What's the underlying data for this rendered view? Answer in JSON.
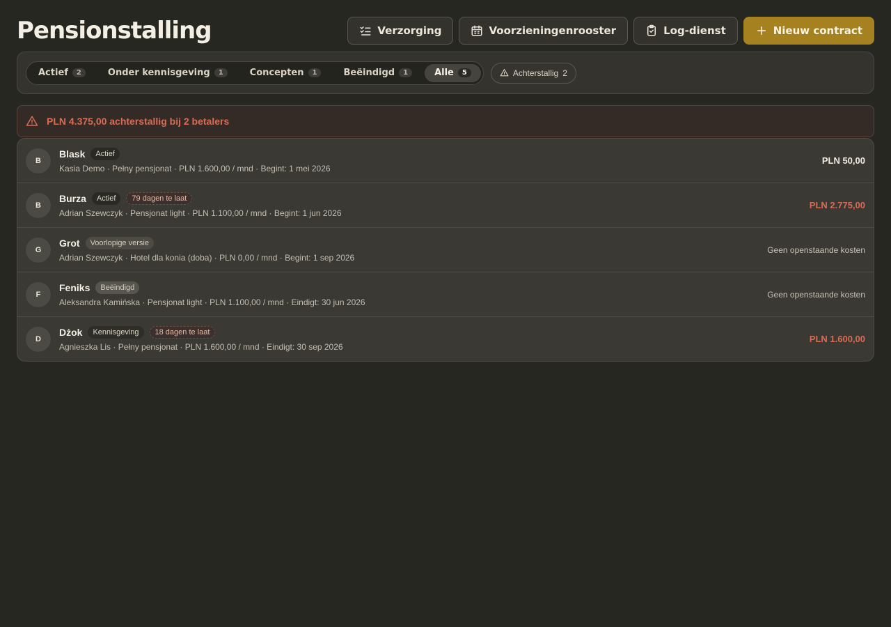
{
  "page": {
    "title": "Pensionstalling"
  },
  "header": {
    "buttons": {
      "care": "Verzorging",
      "schedule": "Voorzieningenrooster",
      "log": "Log-dienst",
      "new_contract": "Nieuw contract"
    }
  },
  "filters": {
    "tabs": [
      {
        "label": "Actief",
        "count": "2"
      },
      {
        "label": "Onder kennisgeving",
        "count": "1"
      },
      {
        "label": "Concepten",
        "count": "1"
      },
      {
        "label": "Beëindigd",
        "count": "1"
      },
      {
        "label": "Alle",
        "count": "5"
      }
    ],
    "active_tab": "Alle",
    "overdue_chip": {
      "label": "Achterstallig",
      "count": "2"
    }
  },
  "alert": {
    "text": "PLN 4.375,00 achterstallig bij 2 betalers"
  },
  "contracts": [
    {
      "initial": "B",
      "name": "Blask",
      "status": "Actief",
      "late": "",
      "details": "Kasia Demo · Pełny pensjonat · PLN 1.600,00 / mnd · Begint: 1 mei 2026",
      "amount": "PLN 50,00"
    },
    {
      "initial": "B",
      "name": "Burza",
      "status": "Actief",
      "late": "79 dagen te laat",
      "details": "Adrian Szewczyk · Pensjonat light · PLN 1.100,00 / mnd · Begint: 1 jun 2026",
      "amount": "PLN 2.775,00"
    },
    {
      "initial": "G",
      "name": "Grot",
      "status": "Voorlopige versie",
      "late": "",
      "details": "Adrian Szewczyk · Hotel dla konia (doba) · PLN 0,00 / mnd · Begint: 1 sep 2026",
      "amount": "Geen openstaande kosten"
    },
    {
      "initial": "F",
      "name": "Feniks",
      "status": "Beëindigd",
      "late": "",
      "details": "Aleksandra Kamińska · Pensjonat light · PLN 1.100,00 / mnd · Eindigt: 30 jun 2026",
      "amount": "Geen openstaande kosten"
    },
    {
      "initial": "D",
      "name": "Dżok",
      "status": "Kennisgeving",
      "late": "18 dagen te laat",
      "details": "Agnieszka Lis · Pełny pensjonat · PLN 1.600,00 / mnd · Eindigt: 30 sep 2026",
      "amount": "PLN 1.600,00"
    }
  ],
  "colors": {
    "background": "#272721",
    "accent": "#a5811f",
    "overdue": "#d86c55"
  }
}
